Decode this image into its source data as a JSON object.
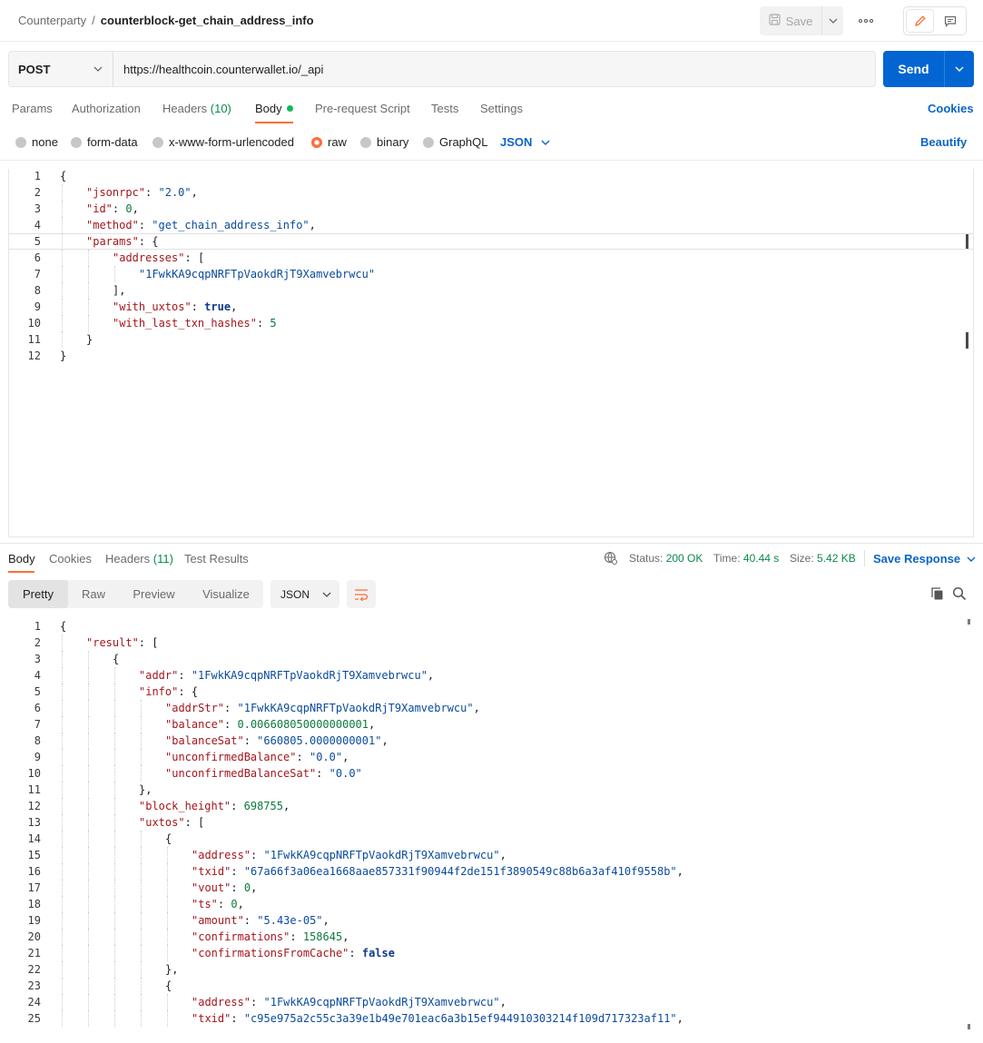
{
  "header": {
    "breadcrumb_parent": "Counterparty",
    "breadcrumb_sep": "/",
    "request_name": "counterblock-get_chain_address_info",
    "save_label": "Save"
  },
  "request": {
    "method": "POST",
    "url": "https://healthcoin.counterwallet.io/_api",
    "send_label": "Send"
  },
  "request_tabs": [
    {
      "label": "Params"
    },
    {
      "label": "Authorization"
    },
    {
      "label": "Headers",
      "count": "(10)"
    },
    {
      "label": "Body"
    },
    {
      "label": "Pre-request Script"
    },
    {
      "label": "Tests"
    },
    {
      "label": "Settings"
    }
  ],
  "cookies_label": "Cookies",
  "body_types": [
    "none",
    "form-data",
    "x-www-form-urlencoded",
    "raw",
    "binary",
    "GraphQL"
  ],
  "body_format": "JSON",
  "beautify_label": "Beautify",
  "request_body_lines": [
    "{",
    "    \"jsonrpc\": \"2.0\",",
    "    \"id\": 0,",
    "    \"method\": \"get_chain_address_info\",",
    "    \"params\": {",
    "        \"addresses\": [",
    "            \"1FwkKA9cqpNRFTpVaokdRjT9Xamvebrwcu\"",
    "        ],",
    "        \"with_uxtos\": true,",
    "        \"with_last_txn_hashes\": 5",
    "    }",
    "}"
  ],
  "response_tabs": [
    {
      "label": "Body"
    },
    {
      "label": "Cookies"
    },
    {
      "label": "Headers",
      "count": "(11)"
    },
    {
      "label": "Test Results"
    }
  ],
  "response_status": {
    "status_label": "Status:",
    "status_value": "200 OK",
    "time_label": "Time:",
    "time_value": "40.44 s",
    "size_label": "Size:",
    "size_value": "5.42 KB",
    "save_response_label": "Save Response"
  },
  "view_modes": [
    "Pretty",
    "Raw",
    "Preview",
    "Visualize"
  ],
  "response_format": "JSON",
  "response_body_lines": [
    "{",
    "    \"result\": [",
    "        {",
    "            \"addr\": \"1FwkKA9cqpNRFTpVaokdRjT9Xamvebrwcu\",",
    "            \"info\": {",
    "                \"addrStr\": \"1FwkKA9cqpNRFTpVaokdRjT9Xamvebrwcu\",",
    "                \"balance\": 0.006608050000000001,",
    "                \"balanceSat\": \"660805.0000000001\",",
    "                \"unconfirmedBalance\": \"0.0\",",
    "                \"unconfirmedBalanceSat\": \"0.0\"",
    "            },",
    "            \"block_height\": 698755,",
    "            \"uxtos\": [",
    "                {",
    "                    \"address\": \"1FwkKA9cqpNRFTpVaokdRjT9Xamvebrwcu\",",
    "                    \"txid\": \"67a66f3a06ea1668aae857331f90944f2de151f3890549c88b6a3af410f9558b\",",
    "                    \"vout\": 0,",
    "                    \"ts\": 0,",
    "                    \"amount\": \"5.43e-05\",",
    "                    \"confirmations\": 158645,",
    "                    \"confirmationsFromCache\": false",
    "                },",
    "                {",
    "                    \"address\": \"1FwkKA9cqpNRFTpVaokdRjT9Xamvebrwcu\",",
    "                    \"txid\": \"c95e975a2c55c3a39e1b49e701eac6a3b15ef944910303214f109d717323af11\","
  ]
}
